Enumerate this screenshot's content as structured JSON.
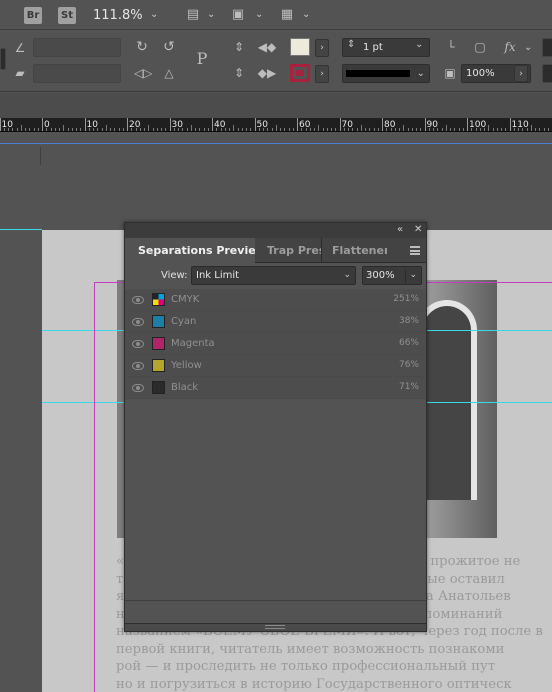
{
  "appbar": {
    "bridge_label": "Br",
    "stock_label": "St",
    "zoom": "111.8%"
  },
  "control": {
    "stroke_weight": "1 pt",
    "opacity": "100%",
    "fx_label": "fx",
    "p_label": "P"
  },
  "ruler": {
    "ticks": [
      "10",
      "0",
      "10",
      "20",
      "30",
      "40",
      "50",
      "60",
      "70",
      "80",
      "90",
      "100",
      "110"
    ]
  },
  "panel": {
    "tabs": [
      "Separations Preview",
      "Trap Prese",
      "Flattener P"
    ],
    "view_label": "View:",
    "view_value": "Ink Limit",
    "limit_value": "300%",
    "inks": [
      {
        "name": "CMYK",
        "value": "251%",
        "color": "multi"
      },
      {
        "name": "Cyan",
        "value": "38%",
        "color": "#1d7fa8"
      },
      {
        "name": "Magenta",
        "value": "66%",
        "color": "#b0246a"
      },
      {
        "name": "Yellow",
        "value": "76%",
        "color": "#b4a62a"
      },
      {
        "name": "Black",
        "value": "71%",
        "color": "#2b2b2b"
      }
    ]
  },
  "document": {
    "lines": [
      "«                                                               слеть прожитое не",
      "т                                                               которые оставил",
      "я                                                               Ирина Анатольев",
      "н                                                               у воспоминаний",
      "названием «ВСЕМУ СВОЁ ВРЕМЯ». И вот, через год после в",
      "первой книги, читатель имеет возможность познакоми",
      "рой — и проследить не только профессиональный пут",
      "но и погрузиться в историю Государственного оптическ"
    ]
  }
}
